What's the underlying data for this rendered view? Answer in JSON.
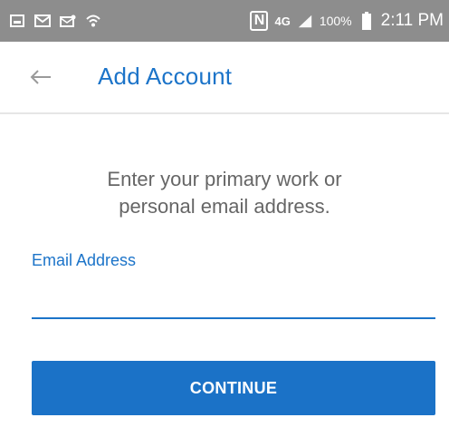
{
  "status_bar": {
    "notification_icons": [
      "gallery-icon",
      "mail-icon",
      "email-icon",
      "wifi-icon"
    ],
    "nfc_label": "N",
    "network_label": "4G",
    "battery_percent": "100%",
    "time": "2:11 PM"
  },
  "app_bar": {
    "title": "Add Account"
  },
  "main": {
    "instruction_line1": "Enter your primary work or",
    "instruction_line2": "personal email address.",
    "email_label": "Email Address",
    "email_value": "",
    "continue_label": "CONTINUE"
  },
  "colors": {
    "accent": "#1b72c7",
    "status_bar": "#8d8d8d",
    "text_muted": "#666666"
  }
}
